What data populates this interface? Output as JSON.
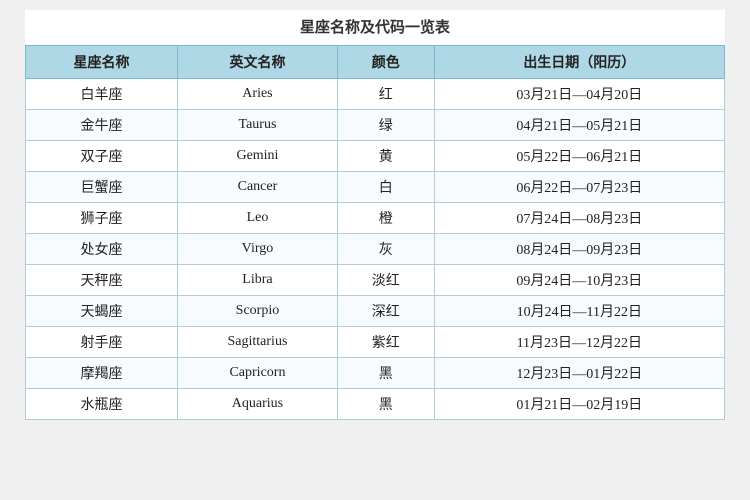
{
  "page": {
    "title": "星座名称及代码一览表"
  },
  "table": {
    "headers": [
      "星座名称",
      "英文名称",
      "颜色",
      "出生日期（阳历）"
    ],
    "rows": [
      {
        "chinese": "白羊座",
        "english": "Aries",
        "color": "红",
        "dates": "03月21日—04月20日"
      },
      {
        "chinese": "金牛座",
        "english": "Taurus",
        "color": "绿",
        "dates": "04月21日—05月21日"
      },
      {
        "chinese": "双子座",
        "english": "Gemini",
        "color": "黄",
        "dates": "05月22日—06月21日"
      },
      {
        "chinese": "巨蟹座",
        "english": "Cancer",
        "color": "白",
        "dates": "06月22日—07月23日"
      },
      {
        "chinese": "狮子座",
        "english": "Leo",
        "color": "橙",
        "dates": "07月24日—08月23日"
      },
      {
        "chinese": "处女座",
        "english": "Virgo",
        "color": "灰",
        "dates": "08月24日—09月23日"
      },
      {
        "chinese": "天秤座",
        "english": "Libra",
        "color": "淡红",
        "dates": "09月24日—10月23日"
      },
      {
        "chinese": "天蝎座",
        "english": "Scorpio",
        "color": "深红",
        "dates": "10月24日—11月22日"
      },
      {
        "chinese": "射手座",
        "english": "Sagittarius",
        "color": "紫红",
        "dates": "11月23日—12月22日"
      },
      {
        "chinese": "摩羯座",
        "english": "Capricorn",
        "color": "黑",
        "dates": "12月23日—01月22日"
      },
      {
        "chinese": "水瓶座",
        "english": "Aquarius",
        "color": "黑",
        "dates": "01月21日—02月19日"
      }
    ]
  }
}
